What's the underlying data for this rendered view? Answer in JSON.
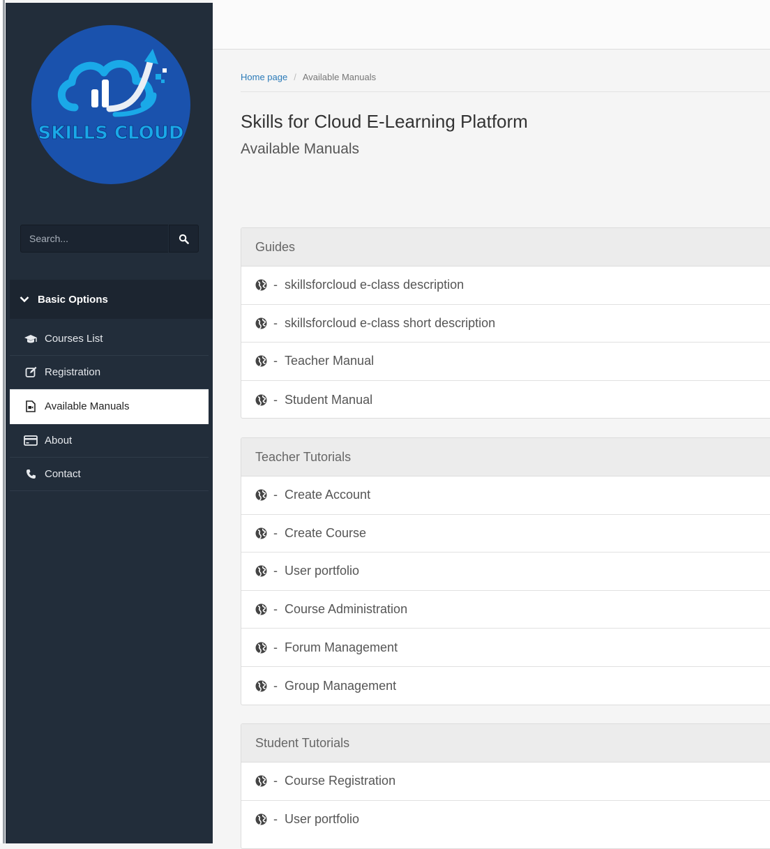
{
  "logo": {
    "text": "SKILLS CLOUD"
  },
  "search": {
    "placeholder": "Search..."
  },
  "sidebar": {
    "section_title": "Basic Options",
    "items": [
      {
        "label": "Courses List",
        "icon": "graduation-cap-icon"
      },
      {
        "label": "Registration",
        "icon": "edit-icon"
      },
      {
        "label": "Available Manuals",
        "icon": "file-video-icon",
        "active": true
      },
      {
        "label": "About",
        "icon": "credit-card-icon"
      },
      {
        "label": "Contact",
        "icon": "phone-icon"
      }
    ]
  },
  "breadcrumb": {
    "home": "Home page",
    "sep": "/",
    "current": "Available Manuals"
  },
  "page": {
    "title": "Skills for Cloud E-Learning Platform",
    "subtitle": "Available Manuals"
  },
  "sections": [
    {
      "title": "Guides",
      "items": [
        "skillsforcloud e-class description",
        "skillsforcloud e-class short description",
        "Teacher Manual",
        "Student Manual"
      ]
    },
    {
      "title": "Teacher Tutorials",
      "items": [
        "Create Account",
        "Create Course",
        "User portfolio",
        "Course Administration",
        "Forum Management",
        "Group Management"
      ]
    },
    {
      "title": "Student Tutorials",
      "items": [
        "Course Registration",
        "User portfolio"
      ]
    }
  ],
  "item_prefix": "-",
  "colors": {
    "sidebar_bg": "#222d3a",
    "logo_circle": "#1a52ad",
    "logo_cyan": "#1aa9e8",
    "link": "#2a7ab8"
  }
}
